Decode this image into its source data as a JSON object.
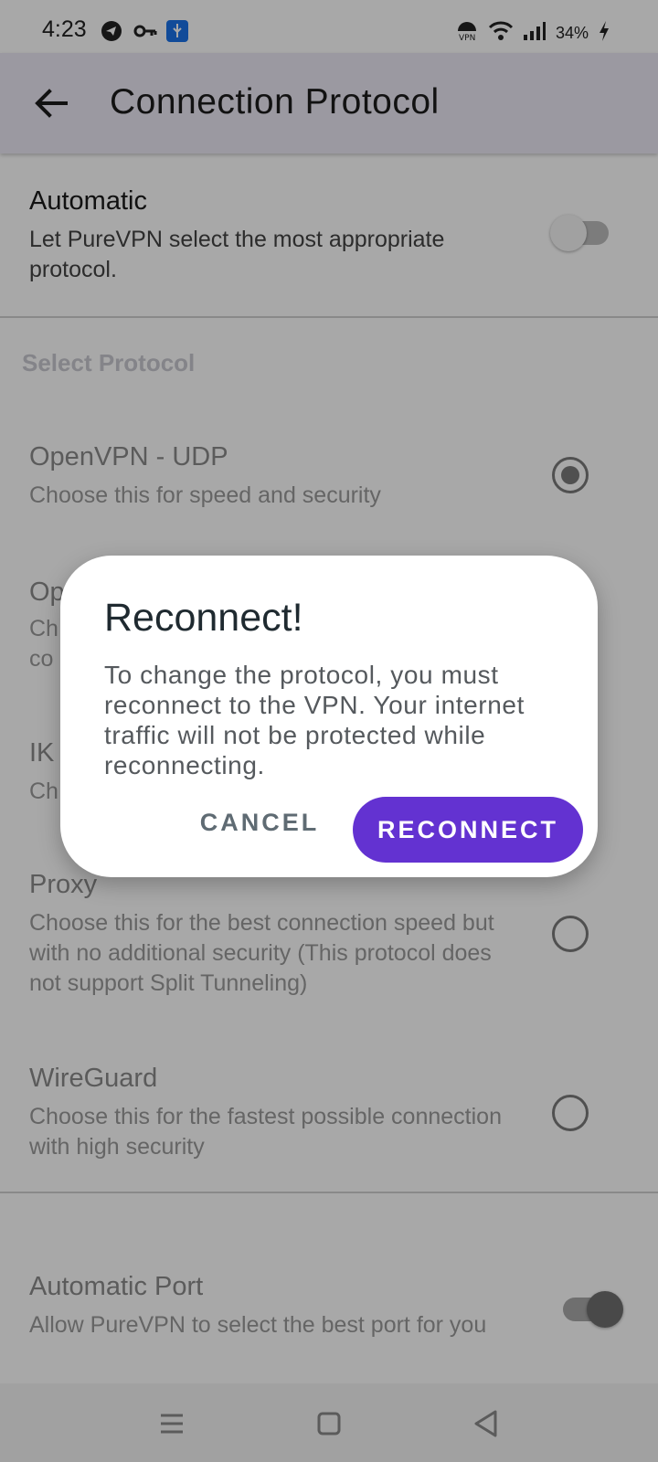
{
  "status_bar": {
    "time": "4:23",
    "battery": "34%",
    "icons": [
      "telegram-icon",
      "vpn-key-icon",
      "usb-icon",
      "vpn-badge-icon",
      "wifi-icon",
      "signal-icon",
      "charging-icon"
    ]
  },
  "app_bar": {
    "back_icon": "arrow-back-icon",
    "title": "Connection Protocol"
  },
  "automatic": {
    "title": "Automatic",
    "description": "Let PureVPN select the most appropriate protocol.",
    "enabled": false
  },
  "section_label": "Select Protocol",
  "protocols": [
    {
      "name": "OpenVPN - UDP",
      "description": "Choose this for speed and security",
      "selected": true
    },
    {
      "name": "Op",
      "description": "Ch\nco",
      "selected": false
    },
    {
      "name": "IK",
      "description": "Ch",
      "selected": false
    },
    {
      "name": "Proxy",
      "description": "Choose this for the best connection speed but with no additional security (This protocol does not support Split Tunneling)",
      "selected": false
    },
    {
      "name": "WireGuard",
      "description": "Choose this for the fastest possible connection with high security",
      "selected": false
    }
  ],
  "automatic_port": {
    "title": "Automatic Port",
    "description": "Allow PureVPN to select the best port for you",
    "enabled": true
  },
  "nav_bar": {
    "icons": [
      "menu-icon",
      "home-square-icon",
      "back-triangle-icon"
    ]
  },
  "dialog": {
    "title": "Reconnect!",
    "body": "To change the protocol, you must reconnect to the VPN. Your internet traffic will not be protected while reconnecting.",
    "cancel_label": "CANCEL",
    "reconnect_label": "RECONNECT"
  },
  "colors": {
    "accent": "#6332d1",
    "app_bar": "#ece8f5"
  }
}
